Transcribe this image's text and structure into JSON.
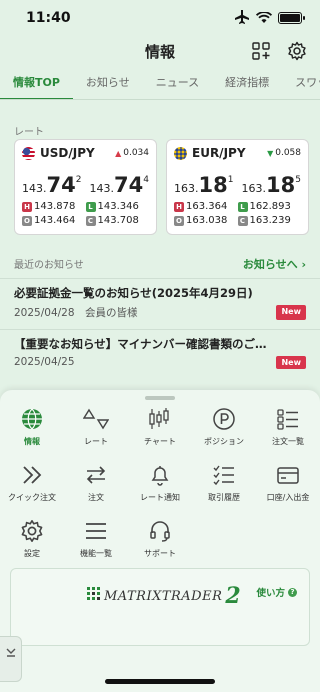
{
  "status": {
    "time": "11:40"
  },
  "header": {
    "title": "情報"
  },
  "tabs": [
    "情報TOP",
    "お知らせ",
    "ニュース",
    "経済指標",
    "スワップ"
  ],
  "rates": {
    "label": "レート",
    "cards": [
      {
        "pair": "USD/JPY",
        "change": "0.034",
        "direction": "up",
        "bid": {
          "prefix": "143.",
          "big": "74",
          "sup": "2"
        },
        "ask": {
          "prefix": "143.",
          "big": "74",
          "sup": "4"
        },
        "high": "143.878",
        "low": "143.346",
        "open": "143.464",
        "close": "143.708"
      },
      {
        "pair": "EUR/JPY",
        "change": "0.058",
        "direction": "down",
        "bid": {
          "prefix": "163.",
          "big": "18",
          "sup": "1"
        },
        "ask": {
          "prefix": "163.",
          "big": "18",
          "sup": "5"
        },
        "high": "163.364",
        "low": "162.893",
        "open": "163.038",
        "close": "163.239"
      }
    ],
    "tags": {
      "h": "H",
      "l": "L",
      "o": "O",
      "c": "C"
    }
  },
  "news": {
    "label": "最近のお知らせ",
    "link": "お知らせへ",
    "items": [
      {
        "title": "必要証拠金一覧のお知らせ(2025年4月29日)",
        "date": "2025/04/28",
        "audience": "会員の皆様",
        "badge": "New"
      },
      {
        "title": "【重要なお知らせ】マイナンバー確認書類のご…",
        "date": "2025/04/25",
        "audience": "",
        "badge": "New"
      }
    ]
  },
  "menu": [
    {
      "label": "情報",
      "icon": "globe-icon",
      "active": true
    },
    {
      "label": "レート",
      "icon": "rate-icon"
    },
    {
      "label": "チャート",
      "icon": "candlestick-icon"
    },
    {
      "label": "ポジション",
      "icon": "position-icon"
    },
    {
      "label": "注文一覧",
      "icon": "order-list-icon"
    },
    {
      "label": "クイック注文",
      "icon": "quick-order-icon"
    },
    {
      "label": "注文",
      "icon": "order-icon"
    },
    {
      "label": "レート通知",
      "icon": "bell-icon"
    },
    {
      "label": "取引履歴",
      "icon": "history-icon"
    },
    {
      "label": "口座/入出金",
      "icon": "wallet-icon"
    },
    {
      "label": "設定",
      "icon": "gear-icon"
    },
    {
      "label": "機能一覧",
      "icon": "menu-icon"
    },
    {
      "label": "サポート",
      "icon": "headset-icon"
    }
  ],
  "banner": {
    "brand": "MATRIXTRADER",
    "brand_num": "2",
    "help": "使い方"
  },
  "colors": {
    "accent": "#2a8a3c",
    "new_badge": "#d8354c",
    "up": "#d63b4a",
    "down": "#2a9a44"
  }
}
